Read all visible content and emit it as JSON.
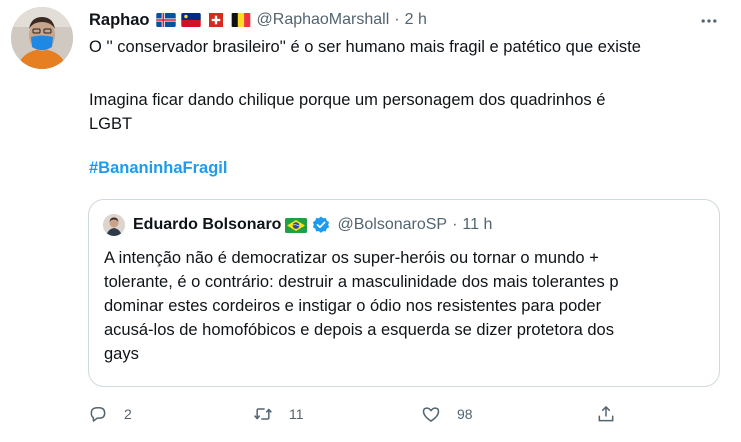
{
  "tweet": {
    "author_name": "Raphao",
    "handle": "@RaphaoMarshall",
    "separator": "·",
    "time": "2 h",
    "lines": [
      "O '' conservador brasileiro'' é o ser humano mais fragil e patético que existe",
      "Imagina ficar dando chilique porque um personagem dos quadrinhos é",
      "LGBT"
    ],
    "hashtag": "#BananinhaFragil",
    "flags": [
      "iceland-flag",
      "liechtenstein-flag",
      "switzerland-flag",
      "belgium-flag"
    ]
  },
  "quote": {
    "author_name": "Eduardo Bolsonaro",
    "handle": "@BolsonaroSP",
    "separator": "·",
    "time": "11 h",
    "flag": "brazil-flag",
    "verified_icon": "verified-badge-icon",
    "lines": [
      "A intenção não é democratizar os super-heróis ou tornar o mundo +",
      "tolerante, é o contrário: destruir a masculinidade dos mais tolerantes p",
      "dominar estes cordeiros e instigar o ódio nos resistentes para poder",
      "acusá-los de homofóbicos e depois a esquerda se dizer protetora dos",
      "gays"
    ]
  },
  "actions": {
    "reply_count": "2",
    "retweet_count": "11",
    "like_count": "98",
    "icons": [
      "reply-icon",
      "retweet-icon",
      "like-icon",
      "share-icon"
    ]
  },
  "colors": {
    "text": "#0f1419",
    "secondary": "#536471",
    "accent": "#1d9bf0",
    "border": "#cfd9de"
  }
}
